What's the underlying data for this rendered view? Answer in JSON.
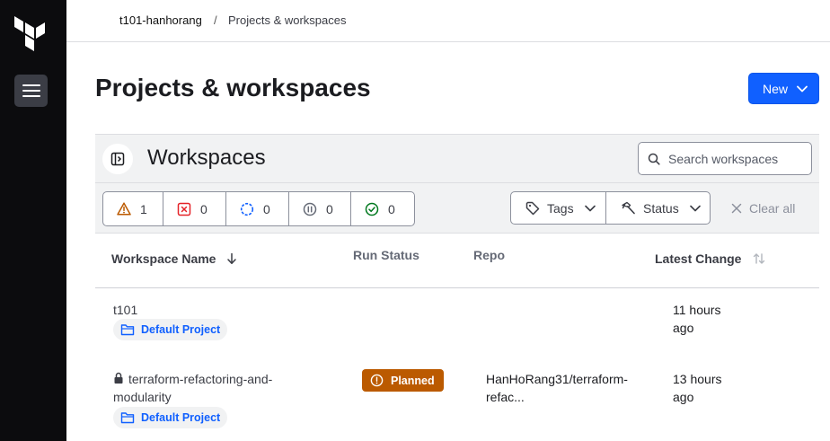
{
  "sidebar": {
    "logo_icon": "terraform-logo-icon",
    "menu_icon": "hamburger-menu-icon"
  },
  "breadcrumb": {
    "org": "t101-hanhorang",
    "separator": "/",
    "page": "Projects & workspaces"
  },
  "header": {
    "title": "Projects & workspaces",
    "new_button": "New"
  },
  "workspaces_panel": {
    "title": "Workspaces",
    "search_placeholder": "Search workspaces",
    "status_counts": [
      {
        "icon": "warning-icon",
        "count": "1",
        "color": "#bb5a00"
      },
      {
        "icon": "error-x-icon",
        "count": "0",
        "color": "#e52228"
      },
      {
        "icon": "running-spinner-icon",
        "count": "0",
        "color": "#1060ff"
      },
      {
        "icon": "paused-icon",
        "count": "0",
        "color": "#656a76"
      },
      {
        "icon": "check-circle-icon",
        "count": "0",
        "color": "#00781e"
      }
    ],
    "filters": {
      "tags": "Tags",
      "status": "Status",
      "clear_all": "Clear all"
    }
  },
  "table": {
    "columns": {
      "name": "Workspace Name",
      "run_status": "Run Status",
      "repo": "Repo",
      "latest_change": "Latest Change"
    },
    "rows": [
      {
        "name": "t101",
        "project": "Default Project",
        "run_status": "",
        "repo": "",
        "latest_line1": "11 hours",
        "latest_line2": "ago",
        "locked": false
      },
      {
        "name_line1": "terraform-refactoring-and-",
        "name_line2": "modularity",
        "project": "Default Project",
        "run_status": "Planned",
        "repo_line1": "HanHoRang31/terraform-",
        "repo_line2": "refac...",
        "latest_line1": "13 hours",
        "latest_line2": "ago",
        "locked": true
      }
    ]
  },
  "colors": {
    "sidebar": "#0c0c0e",
    "primary": "#1060ff",
    "planned_badge": "#bb5a00"
  }
}
